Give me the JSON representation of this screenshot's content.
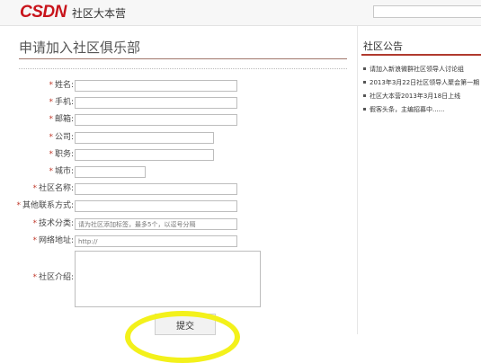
{
  "header": {
    "logo": "CSDN",
    "site_title": "社区大本营",
    "search_value": ""
  },
  "main": {
    "title": "申请加入社区俱乐部",
    "required_mark": "*",
    "fields": [
      {
        "label": "姓名:",
        "value": "",
        "placeholder": ""
      },
      {
        "label": "手机:",
        "value": "",
        "placeholder": ""
      },
      {
        "label": "邮箱:",
        "value": "",
        "placeholder": ""
      },
      {
        "label": "公司:",
        "value": "",
        "placeholder": ""
      },
      {
        "label": "职务:",
        "value": "",
        "placeholder": ""
      },
      {
        "label": "城市:",
        "value": "",
        "placeholder": ""
      },
      {
        "label": "社区名称:",
        "value": "",
        "placeholder": ""
      },
      {
        "label": "其他联系方式:",
        "value": "",
        "placeholder": ""
      },
      {
        "label": "技术分类:",
        "value": "",
        "placeholder": "请为社区添加标签，最多5个，以逗号分隔"
      },
      {
        "label": "网络地址:",
        "value": "http://",
        "placeholder": ""
      },
      {
        "label": "社区介绍:",
        "value": "",
        "placeholder": ""
      }
    ],
    "submit_label": "提交"
  },
  "sidebar": {
    "title": "社区公告",
    "items": [
      "请加入新浪微群社区领导人讨论组",
      "2013年3月22日社区领导人聚会第一期",
      "社区大本营2013年3月18日上线",
      "假客头条，主编招募中......"
    ]
  },
  "annotation": {
    "color": "#f3f11b"
  }
}
